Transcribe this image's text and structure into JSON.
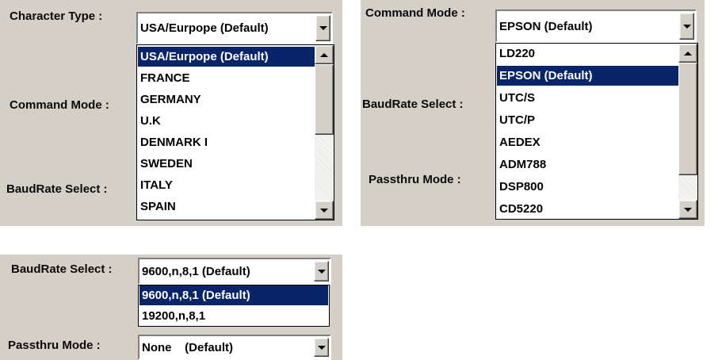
{
  "panel1": {
    "character_type_label": "Character Type :",
    "character_type_value": "USA/Eurpope  (Default)",
    "command_mode_label": "Command Mode :",
    "baudrate_label": "BaudRate Select :",
    "options": [
      "USA/Eurpope  (Default)",
      "FRANCE",
      "GERMANY",
      "U.K",
      "DENMARK I",
      "SWEDEN",
      "ITALY",
      "SPAIN"
    ],
    "selected_index": 0
  },
  "panel2": {
    "command_mode_label": "Command Mode :",
    "command_mode_value": "EPSON (Default)",
    "baudrate_label": "BaudRate Select :",
    "passthru_label": "Passthru Mode :",
    "options": [
      "LD220",
      "EPSON (Default)",
      "UTC/S",
      "UTC/P",
      "AEDEX",
      "ADM788",
      "DSP800",
      "CD5220"
    ],
    "selected_index": 1
  },
  "panel3": {
    "baudrate_label": "BaudRate Select :",
    "baudrate_value": "9600,n,8,1 (Default)",
    "options": [
      "9600,n,8,1 (Default)",
      "19200,n,8,1"
    ],
    "selected_index": 0,
    "passthru_label": "Passthru Mode :",
    "passthru_value": "None    (Default)"
  },
  "colors": {
    "panel_bg": "#d4d0c8",
    "highlight": "#0a246a",
    "list_bg": "#ffffff"
  },
  "icons": [
    "dropdown-arrow-icon",
    "scroll-up-arrow-icon",
    "scroll-down-arrow-icon"
  ]
}
